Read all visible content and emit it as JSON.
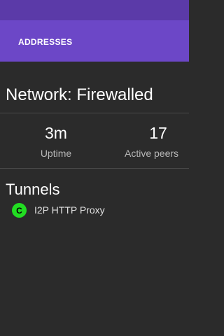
{
  "tabs": [
    {
      "label": "ADDRESSES"
    }
  ],
  "network": {
    "status": "Network: Firewalled"
  },
  "stats": {
    "uptime": {
      "value": "3m",
      "label": "Uptime"
    },
    "active_peers": {
      "value": "17",
      "label": "Active peers"
    }
  },
  "tunnels": {
    "heading": "Tunnels",
    "items": [
      {
        "badge": "C",
        "name": "I2P HTTP Proxy"
      }
    ]
  },
  "colors": {
    "status_bar": "#5b3aa8",
    "app_bar": "#6c47c7",
    "background": "#2b2b2b",
    "tunnel_ok": "#22dd22"
  }
}
